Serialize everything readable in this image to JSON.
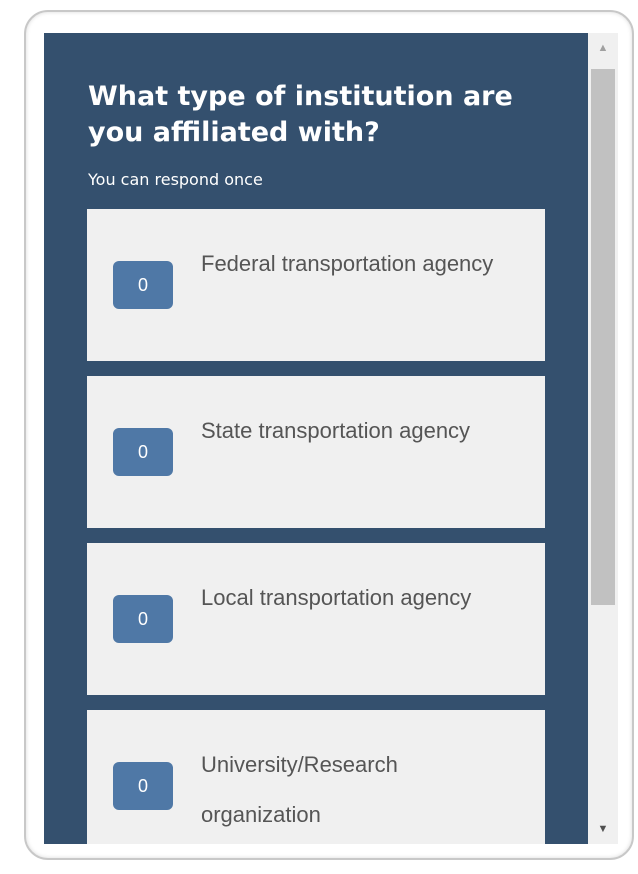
{
  "poll": {
    "question": "What type of institution are you affiliated with?",
    "subtitle": "You can respond once",
    "options": [
      {
        "count": "0",
        "label": "Federal transportation agency"
      },
      {
        "count": "0",
        "label": "State transportation agency"
      },
      {
        "count": "0",
        "label": "Local transportation agency"
      },
      {
        "count": "0",
        "label": "University/Research organization"
      }
    ]
  },
  "scrollbar": {
    "up_icon": "scroll-up-arrow-icon",
    "down_icon": "scroll-down-arrow-icon"
  },
  "colors": {
    "panel_background": "#34506e",
    "option_background": "#f0f0f0",
    "count_badge": "#4f78a6",
    "label_text": "#555555"
  }
}
